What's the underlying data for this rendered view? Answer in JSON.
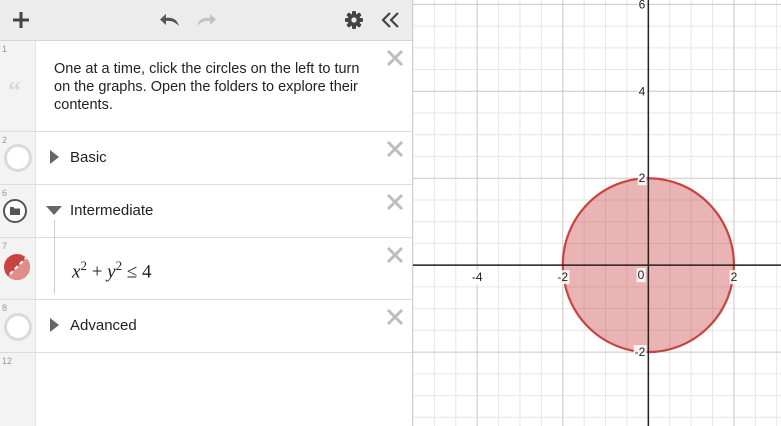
{
  "toolbar": {
    "add_icon": "plus-icon",
    "undo_icon": "undo-icon",
    "redo_icon": "redo-icon",
    "settings_icon": "gear-icon",
    "collapse_icon": "double-chevron-left-icon"
  },
  "expressions": [
    {
      "num": "1",
      "type": "note",
      "text": "One at a time, click the circles on the left to turn on the graphs. Open the folders to explore their contents."
    },
    {
      "num": "2",
      "type": "folder",
      "label": "Basic",
      "collapsed": true
    },
    {
      "num": "6",
      "type": "folder",
      "label": "Intermediate",
      "collapsed": false
    },
    {
      "num": "7",
      "type": "expression",
      "latex": "x^2 + y^2 ≤ 4",
      "color": "#c74440"
    },
    {
      "num": "8",
      "type": "folder",
      "label": "Advanced",
      "collapsed": true
    },
    {
      "num": "12",
      "type": "empty"
    }
  ],
  "math": {
    "x": "x",
    "y": "y",
    "exp1": "2",
    "exp2": "2",
    "plus": " + ",
    "rel": " ≤ 4"
  },
  "graph": {
    "xrange": [
      -5.5,
      3.1
    ],
    "yrange": [
      -3.7,
      6.1
    ],
    "grid_minor": 0.5,
    "grid_major": 2,
    "x_ticks": [
      "-4",
      "-2",
      "0",
      "2"
    ],
    "y_ticks": [
      "6",
      "4",
      "2",
      "-2"
    ],
    "shape": {
      "type": "disk",
      "center": [
        0,
        0
      ],
      "radius": 2,
      "color": "#c74440"
    }
  }
}
